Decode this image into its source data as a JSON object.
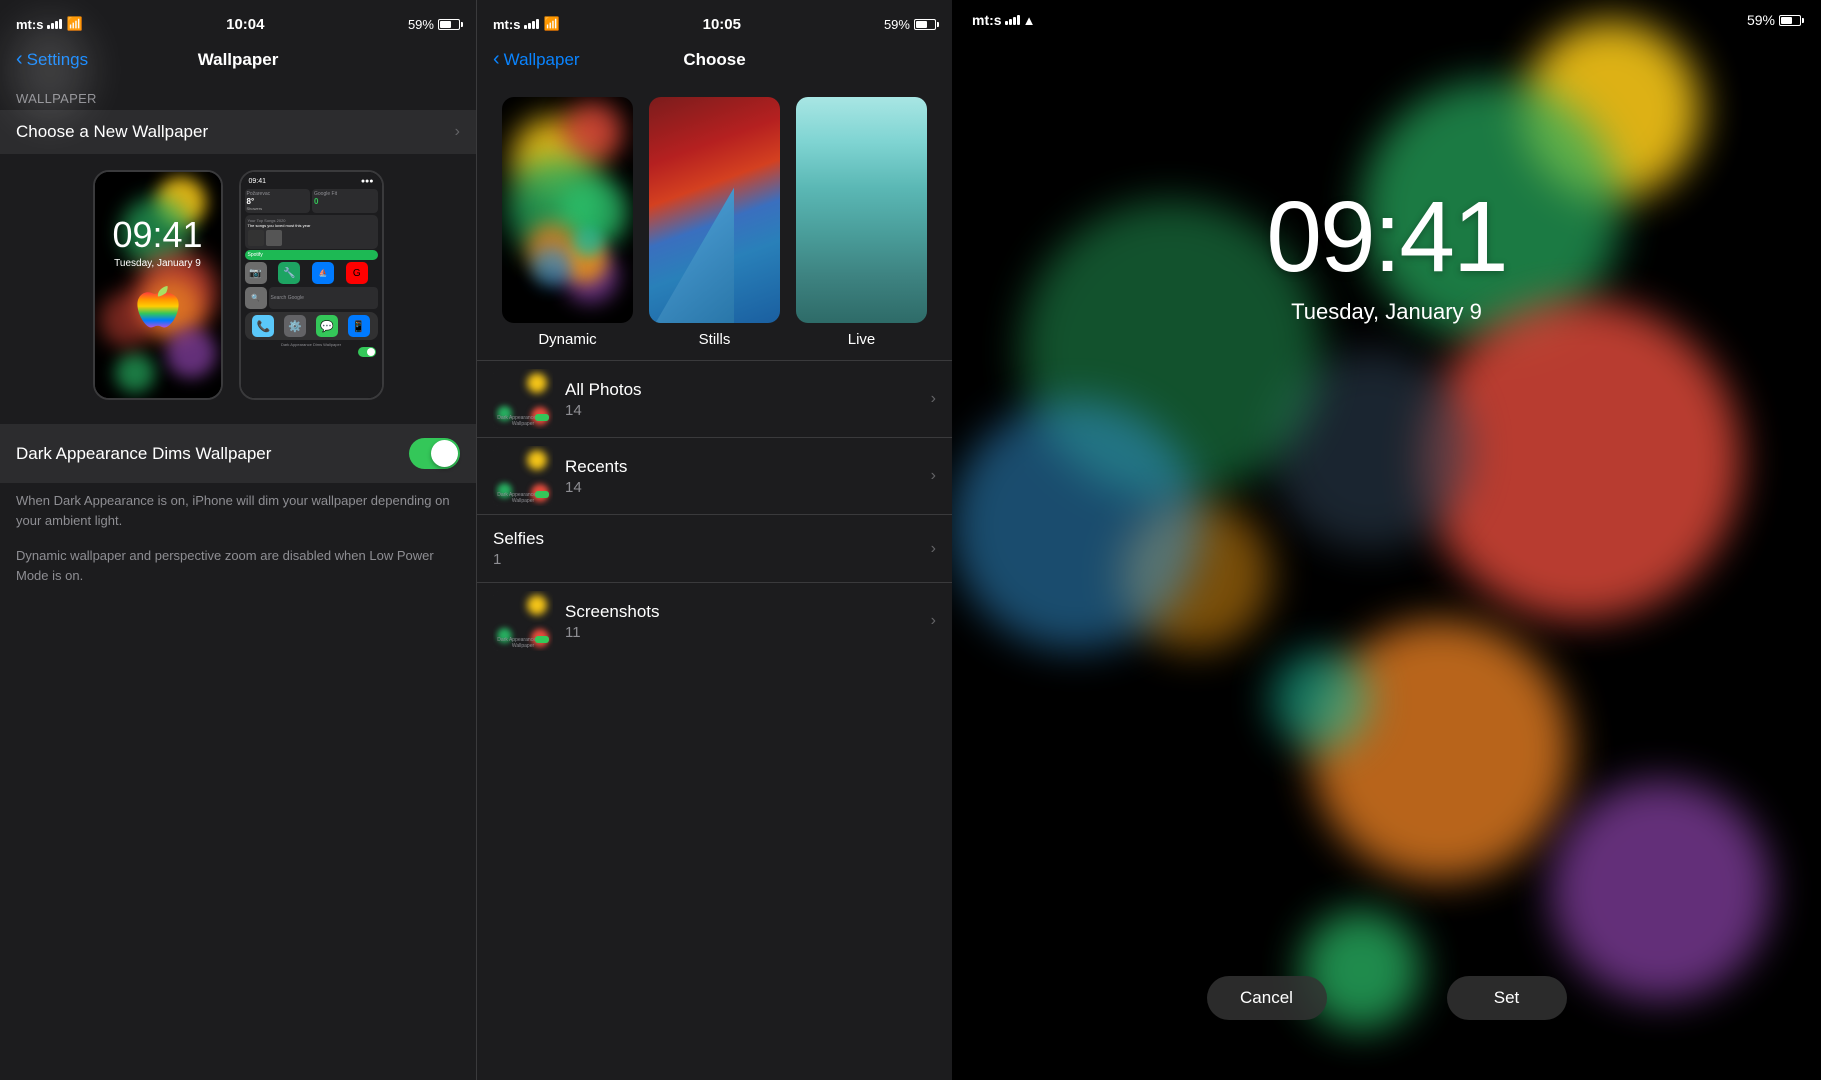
{
  "panel1": {
    "statusBar": {
      "carrier": "mt:s",
      "wifi": "wifi",
      "time": "10:04",
      "battery": "59%",
      "signal": true
    },
    "navBar": {
      "backLabel": "Settings",
      "title": "Wallpaper"
    },
    "sectionHeader": "WALLPAPER",
    "chooseLabel": "Choose a New Wallpaper",
    "preview1": {
      "time": "09:41",
      "date": "Tuesday, January 9"
    },
    "toggleLabel": "Dark Appearance Dims Wallpaper",
    "toggleOn": true,
    "desc1": "When Dark Appearance is on, iPhone will dim your wallpaper depending on your ambient light.",
    "desc2": "Dynamic wallpaper and perspective zoom are disabled when Low Power Mode is on."
  },
  "panel2": {
    "statusBar": {
      "carrier": "mt:s",
      "wifi": "wifi",
      "time": "10:05",
      "battery": "59%",
      "signal": true
    },
    "navBar": {
      "backLabel": "Wallpaper",
      "title": "Choose"
    },
    "categories": [
      {
        "label": "Dynamic"
      },
      {
        "label": "Stills"
      },
      {
        "label": "Live"
      }
    ],
    "photoGroups": [
      {
        "title": "All Photos",
        "count": "14"
      },
      {
        "title": "Recents",
        "count": "14"
      },
      {
        "title": "Selfies",
        "count": "1"
      },
      {
        "title": "Screenshots",
        "count": "11"
      }
    ]
  },
  "panel3": {
    "statusBar": {
      "carrier": "mt:s",
      "wifi": "wifi",
      "battery": "59%"
    },
    "time": "09:41",
    "date": "Tuesday, January 9",
    "cancelLabel": "Cancel",
    "setLabel": "Set"
  }
}
